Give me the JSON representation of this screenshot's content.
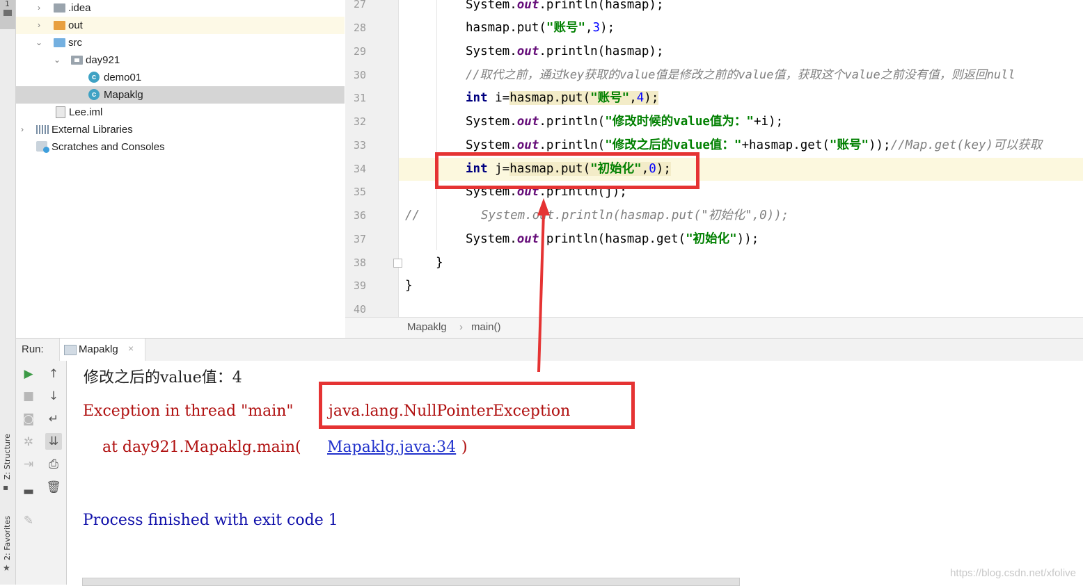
{
  "left_strip": {
    "project_tab_number": "1",
    "structure_tab": "Z: Structure",
    "favorites_tab": "2: Favorites"
  },
  "project_tree": {
    "items": [
      {
        "label": ".idea",
        "expanded": false
      },
      {
        "label": "out",
        "expanded": false
      },
      {
        "label": "src",
        "expanded": true
      },
      {
        "label": "day921",
        "expanded": true
      },
      {
        "label": "demo01"
      },
      {
        "label": "Mapaklg",
        "selected": true
      },
      {
        "label": "Lee.iml"
      },
      {
        "label": "External Libraries",
        "expanded": false
      },
      {
        "label": "Scratches and Consoles"
      }
    ]
  },
  "editor": {
    "line_numbers": [
      "27",
      "28",
      "29",
      "30",
      "31",
      "32",
      "33",
      "34",
      "35",
      "36",
      "37",
      "38",
      "39",
      "40"
    ],
    "lines": [
      {
        "n": "27",
        "p1": "System.",
        "f": "out",
        "p2": ".println(hasmap);"
      },
      {
        "n": "28",
        "p1": "hasmap.put(",
        "s": "\"账号\"",
        "p2": ",",
        "num": "3",
        "p3": ");"
      },
      {
        "n": "29",
        "p1": "System.",
        "f": "out",
        "p2": ".println(hasmap);"
      },
      {
        "n": "30",
        "comment": "//取代之前，通过key获取的value值是修改之前的value值，获取这个value之前没有值，则返回null"
      },
      {
        "n": "31",
        "kw": "int",
        "p1": " i=",
        "p2": "hasmap.put(",
        "s": "\"账号\"",
        "p3": ",",
        "num": "4",
        "p4": ");"
      },
      {
        "n": "32",
        "p1": "System.",
        "f": "out",
        "p2": ".println(",
        "s": "\"修改时候的value值为：\"",
        "p3": "+i);"
      },
      {
        "n": "33",
        "p1": "System.",
        "f": "out",
        "p2": ".println(",
        "s": "\"修改之后的value值：\"",
        "p3": "+hasmap.get(",
        "s2": "\"账号\"",
        "p4": "));",
        "comment": "//Map.get(key)可以获取"
      },
      {
        "n": "34",
        "kw": "int",
        "p1": " j=",
        "p2": "hasmap.put(",
        "s": "\"初始化\"",
        "p3": ",",
        "num": "0",
        "p4": ");"
      },
      {
        "n": "35",
        "p1": "System.",
        "f": "out",
        "p2": ".println(j);"
      },
      {
        "n": "36",
        "comment_a": "//",
        "comment_b": "System.out.println(hasmap.put(\"初始化\",0));"
      },
      {
        "n": "37",
        "p1": "System.",
        "f": "out",
        "p2": ".println(hasmap.get(",
        "s": "\"初始化\"",
        "p3": "));"
      },
      {
        "n": "38",
        "p1": "}"
      },
      {
        "n": "39",
        "p1": "}"
      }
    ]
  },
  "breadcrumbs": {
    "class_name": "Mapaklg",
    "separator": "›",
    "method": "main()"
  },
  "run": {
    "label": "Run:",
    "tab_label": "Mapaklg",
    "close_glyph": "×"
  },
  "console": {
    "line1": "修改之后的value值：4",
    "exception_prefix": "Exception in thread \"main\" ",
    "exception_name": "java.lang.NullPointerException",
    "at_prefix": "    at day921.Mapaklg.main(",
    "at_link": "Mapaklg.java:34",
    "at_suffix": ")",
    "process": "Process finished with exit code 1"
  },
  "icons": {
    "run": "play-icon",
    "stop": "stop-icon",
    "up": "arrow-up-icon",
    "down": "arrow-down-icon"
  },
  "colors": {
    "annotation_red": "#e53333",
    "keyword": "#000080",
    "string": "#008000",
    "error": "#b01010"
  },
  "watermark": "https://blog.csdn.net/xfolive"
}
